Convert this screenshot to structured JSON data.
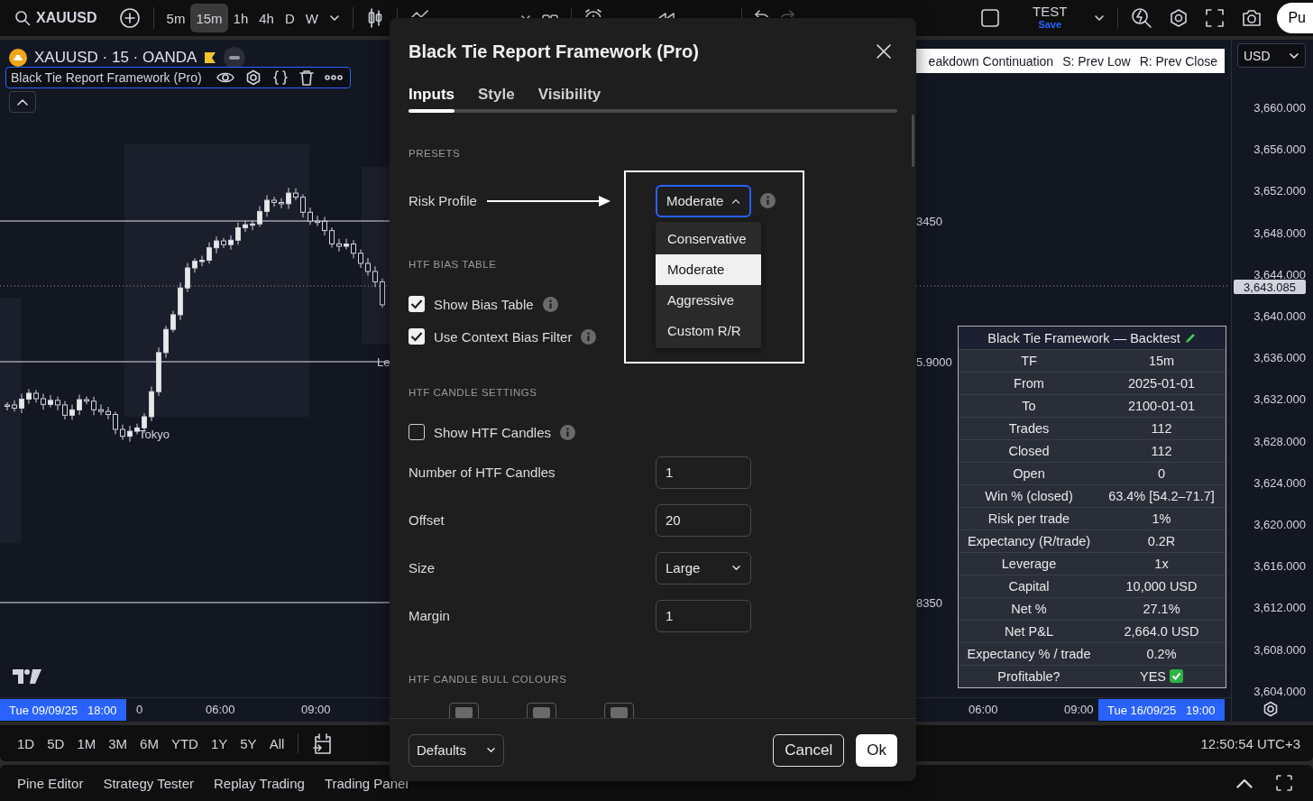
{
  "toolbar": {
    "symbol": "XAUUSD",
    "intervals": [
      {
        "label": "5m",
        "selected": false
      },
      {
        "label": "15m",
        "selected": true
      },
      {
        "label": "1h",
        "selected": false
      },
      {
        "label": "4h",
        "selected": false
      },
      {
        "label": "D",
        "selected": false
      },
      {
        "label": "W",
        "selected": false
      }
    ],
    "layout_name": "TEST",
    "save": "Save",
    "publish": "Pu"
  },
  "chart": {
    "legend": "XAUUSD · 15 · OANDA",
    "indicator": "Black Tie Report Framework (Pro)",
    "session_label": "Tokyo",
    "level_labels": [
      {
        "text": "3450"
      },
      {
        "text": "5.9000"
      },
      {
        "text": "8350"
      }
    ],
    "line_tag": "Le",
    "signal_label": [
      "eakdown Continuation",
      "S: Prev Low",
      "R: Prev Close"
    ],
    "currency": "USD",
    "price_ticks": [
      "3,660.000",
      "3,656.000",
      "3,652.000",
      "3,648.000",
      "3,644.000",
      "3,640.000",
      "3,636.000",
      "3,632.000",
      "3,628.000",
      "3,624.000",
      "3,620.000",
      "3,616.000",
      "3,612.000",
      "3,608.000",
      "3,604.000"
    ],
    "current_price": "3,643.085",
    "time_labels": [
      "0",
      "06:00",
      "09:00",
      "06:00",
      "09:00"
    ],
    "start_badge": "Tue 09/09/25   18:00",
    "end_badge": "Tue 16/09/25   19:00",
    "backtest": {
      "title": "Black Tie Framework — Backtest",
      "rows": [
        {
          "label": "TF",
          "value": "15m",
          "check": false
        },
        {
          "label": "From",
          "value": "2025-01-01",
          "check": false
        },
        {
          "label": "To",
          "value": "2100-01-01",
          "check": false
        },
        {
          "label": "Trades",
          "value": "112",
          "check": false
        },
        {
          "label": "Closed",
          "value": "112",
          "check": false
        },
        {
          "label": "Open",
          "value": "0",
          "check": false
        },
        {
          "label": "Win % (closed)",
          "value": "63.4% [54.2–71.7]",
          "check": false
        },
        {
          "label": "Risk per trade",
          "value": "1%",
          "check": false
        },
        {
          "label": "Expectancy (R/trade)",
          "value": "0.2R",
          "check": false
        },
        {
          "label": "Leverage",
          "value": "1x",
          "check": false
        },
        {
          "label": "Capital",
          "value": "10,000 USD",
          "check": false
        },
        {
          "label": "Net %",
          "value": "27.1%",
          "check": false
        },
        {
          "label": "Net P&L",
          "value": "2,664.0 USD",
          "check": false
        },
        {
          "label": "Expectancy % / trade",
          "value": "0.2%",
          "check": false
        },
        {
          "label": "Profitable?",
          "value": "YES",
          "check": true
        }
      ]
    }
  },
  "range_bar": {
    "ranges": [
      "1D",
      "5D",
      "1M",
      "3M",
      "6M",
      "YTD",
      "1Y",
      "5Y",
      "All"
    ],
    "clock": "12:50:54 UTC+3"
  },
  "bottom_tabs": [
    "Pine Editor",
    "Strategy Tester",
    "Replay Trading",
    "Trading Panel"
  ],
  "dialog": {
    "title": "Black Tie Report Framework (Pro)",
    "tabs": [
      {
        "label": "Inputs",
        "selected": true
      },
      {
        "label": "Style",
        "selected": false
      },
      {
        "label": "Visibility",
        "selected": false
      }
    ],
    "sections": [
      {
        "heading": "PRESETS",
        "inputs": [
          {
            "kind": "select",
            "label": "Risk Profile",
            "value": "Moderate",
            "info": true,
            "expanded": true,
            "options": [
              {
                "label": "Conservative",
                "selected": false
              },
              {
                "label": "Moderate",
                "selected": true
              },
              {
                "label": "Aggressive",
                "selected": false
              },
              {
                "label": "Custom R/R",
                "selected": false
              }
            ]
          }
        ]
      },
      {
        "heading": "HTF BIAS TABLE",
        "inputs": [
          {
            "kind": "checkbox",
            "label": "Show Bias Table",
            "checked": true,
            "info": true
          },
          {
            "kind": "checkbox",
            "label": "Use Context Bias Filter",
            "checked": true,
            "info": true
          }
        ]
      },
      {
        "heading": "HTF CANDLE SETTINGS",
        "inputs": [
          {
            "kind": "checkbox",
            "label": "Show HTF Candles",
            "checked": false,
            "info": true
          },
          {
            "kind": "number",
            "label": "Number of HTF Candles",
            "value": "1"
          },
          {
            "kind": "number",
            "label": "Offset",
            "value": "20"
          },
          {
            "kind": "select",
            "label": "Size",
            "value": "Large",
            "info": false,
            "expanded": false
          },
          {
            "kind": "number",
            "label": "Margin",
            "value": "1"
          }
        ]
      },
      {
        "heading": "HTF CANDLE BULL COLOURS",
        "inputs": [
          {
            "kind": "swatches"
          }
        ]
      }
    ],
    "defaults": "Defaults",
    "buttons": [
      {
        "label": "Cancel",
        "kind": "secondary"
      },
      {
        "label": "Ok",
        "kind": "primary"
      }
    ]
  }
}
